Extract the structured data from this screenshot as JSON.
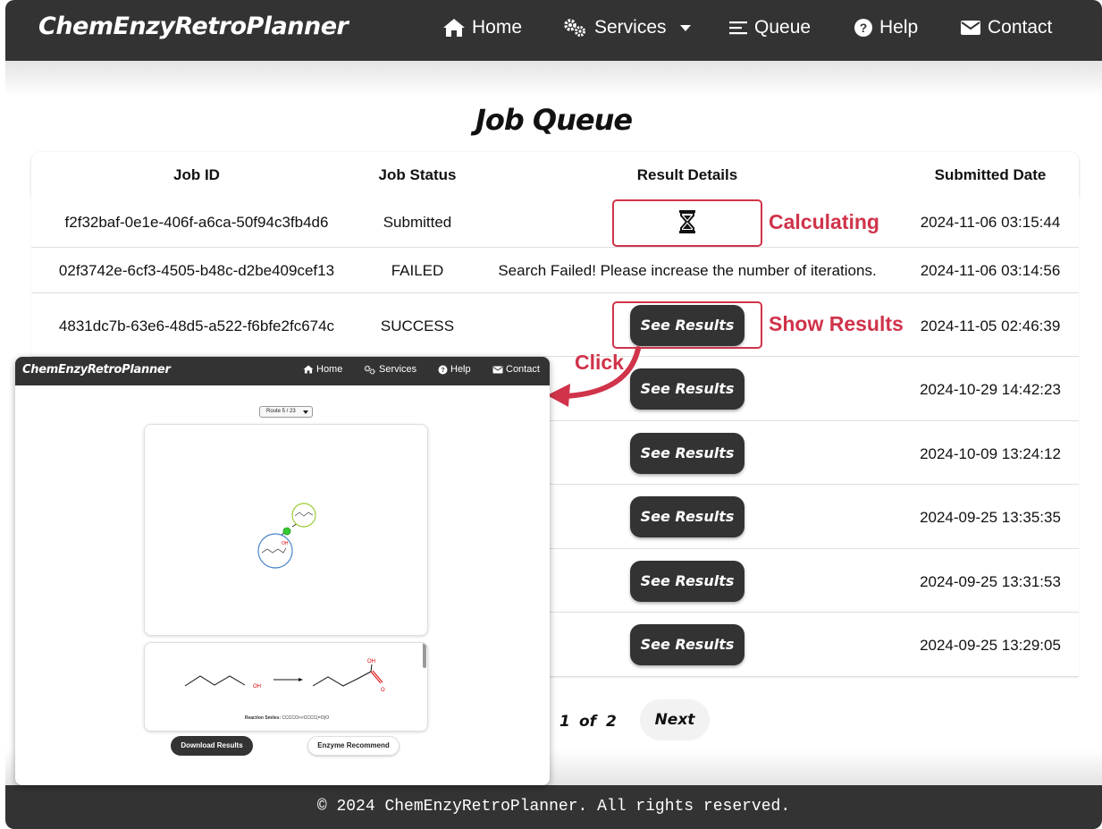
{
  "nav": {
    "brand": "ChemEnzyRetroPlanner",
    "items": [
      {
        "label": "Home",
        "icon": "home-icon"
      },
      {
        "label": "Services",
        "icon": "gears-icon"
      },
      {
        "label": "Queue",
        "icon": "list-icon"
      },
      {
        "label": "Help",
        "icon": "question-circle-icon"
      },
      {
        "label": "Contact",
        "icon": "envelope-icon"
      }
    ]
  },
  "page": {
    "title": "Job Queue"
  },
  "table": {
    "headers": [
      "Job ID",
      "Job Status",
      "Result Details",
      "Submitted Date"
    ],
    "see_results_label": "See Results",
    "rows": [
      {
        "job_id": "f2f32baf-0e1e-406f-a6ca-50f94c3fb4d6",
        "status": "Submitted",
        "result": "hourglass-icon",
        "date": "2024-11-06 03:15:44"
      },
      {
        "job_id": "02f3742e-6cf3-4505-b48c-d2be409cef13",
        "status": "FAILED",
        "result": "Search Failed! Please increase the number of iterations.",
        "date": "2024-11-06 03:14:56"
      },
      {
        "job_id": "4831dc7b-63e6-48d5-a522-f6bfe2fc674c",
        "status": "SUCCESS",
        "result": "See Results",
        "date": "2024-11-05 02:46:39"
      },
      {
        "result": "See Results",
        "date": "2024-10-29 14:42:23"
      },
      {
        "result": "See Results",
        "date": "2024-10-09 13:24:12"
      },
      {
        "result": "See Results",
        "date": "2024-09-25 13:35:35"
      },
      {
        "result": "See Results",
        "date": "2024-09-25 13:31:53"
      },
      {
        "result": "See Results",
        "date": "2024-09-25 13:29:05"
      }
    ]
  },
  "annotations": {
    "calculating": "Calculating",
    "show_results": "Show Results",
    "click": "Click",
    "color": "#d0334a"
  },
  "pagination": {
    "current": "1",
    "of": "of",
    "total": "2",
    "next_label": "Next"
  },
  "footer": {
    "text": "© 2024 ChemEnzyRetroPlanner. All rights reserved."
  },
  "inset": {
    "brand": "ChemEnzyRetroPlanner",
    "nav": [
      "Home",
      "Services",
      "Help",
      "Contact"
    ],
    "route_select": "Route 5 / 23",
    "reaction_smiles_label": "Reaction Smiles:",
    "reaction_smiles": "CCCCO>>CCCC(=O)O",
    "oh_label": "OH",
    "o_label": "O",
    "download_button": "Download Results",
    "enzyme_button": "Enzyme Recommend"
  },
  "colors": {
    "navbar": "#333333",
    "accent_red": "#d0334a",
    "button_dark": "#333333"
  }
}
